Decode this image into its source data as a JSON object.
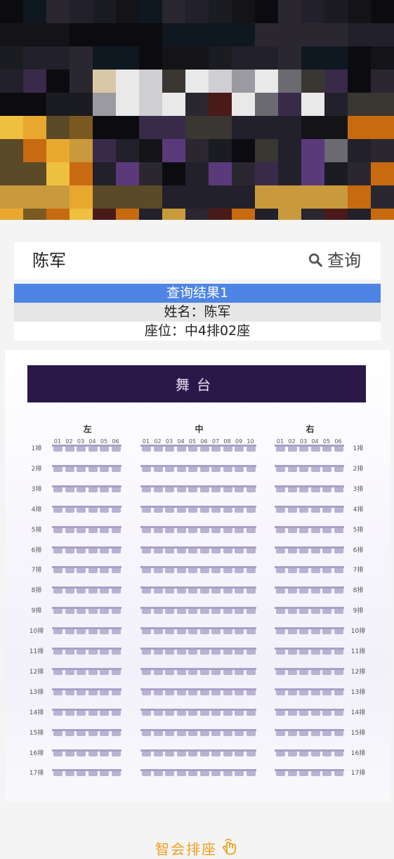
{
  "hero": {
    "palette": [
      "#0c0c10",
      "#141418",
      "#1b1b22",
      "#22202a",
      "#2b2730",
      "#3a3632",
      "#0f1820",
      "#5a4a28",
      "#c89a3c",
      "#e8a830",
      "#7a5a20",
      "#d8c8a8",
      "#e9e9ea",
      "#cfcfd3",
      "#9a9aa0",
      "#6a6a70",
      "#4a1a18",
      "#3a2a4a",
      "#5a3a7a",
      "#2a4a4a",
      "#8a6a3a",
      "#c86a10",
      "#f0c040",
      "#7a7a8a",
      "#b8b8c0"
    ]
  },
  "search": {
    "value": "陈军",
    "button_label": "查询",
    "icon": "search-icon"
  },
  "result": {
    "title": "查询结果1",
    "name_line": "姓名：陈军",
    "seat_line": "座位：中4排02座",
    "title_bg": "#4e84e4"
  },
  "seatmap": {
    "stage_label": "舞台",
    "stage_color": "#2c1749",
    "seat_color": "#b9b2d3",
    "sections": [
      {
        "key": "left",
        "title": "左",
        "columns": [
          "01",
          "02",
          "03",
          "04",
          "05",
          "06"
        ]
      },
      {
        "key": "middle",
        "title": "中",
        "columns": [
          "01",
          "02",
          "03",
          "04",
          "05",
          "06",
          "07",
          "08",
          "09",
          "10"
        ]
      },
      {
        "key": "right",
        "title": "右",
        "columns": [
          "01",
          "02",
          "03",
          "04",
          "05",
          "06"
        ]
      }
    ],
    "rows": [
      "1排",
      "2排",
      "3排",
      "4排",
      "5排",
      "6排",
      "7排",
      "8排",
      "9排",
      "10排",
      "11排",
      "12排",
      "13排",
      "14排",
      "15排",
      "16排",
      "17排"
    ]
  },
  "footer": {
    "smart_link_label": "智会排座",
    "icon": "hand-pointer-icon",
    "accent": "#f0a020"
  }
}
